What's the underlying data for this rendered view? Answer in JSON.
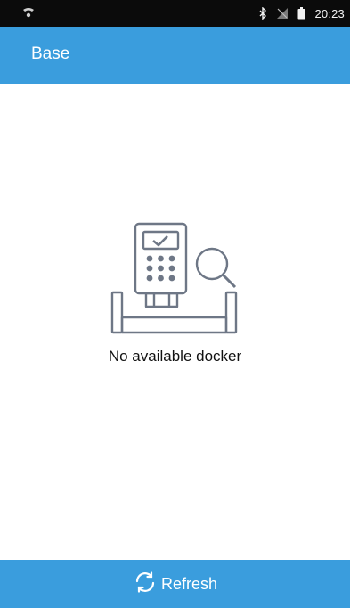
{
  "status_bar": {
    "time": "20:23",
    "icons": [
      "notification-icon",
      "bluetooth-icon",
      "no-signal-icon",
      "battery-icon"
    ]
  },
  "app_bar": {
    "title": "Base"
  },
  "empty_state": {
    "message": "No available docker",
    "illustration": "pos-terminal-dock-search-illustration"
  },
  "bottom_bar": {
    "refresh_label": "Refresh",
    "refresh_icon": "refresh-icon"
  },
  "colors": {
    "status_bar": "#0b0b0b",
    "primary": "#3a9ddd",
    "background": "#ffffff",
    "text": "#111111",
    "illustration_stroke": "#6e7786"
  }
}
